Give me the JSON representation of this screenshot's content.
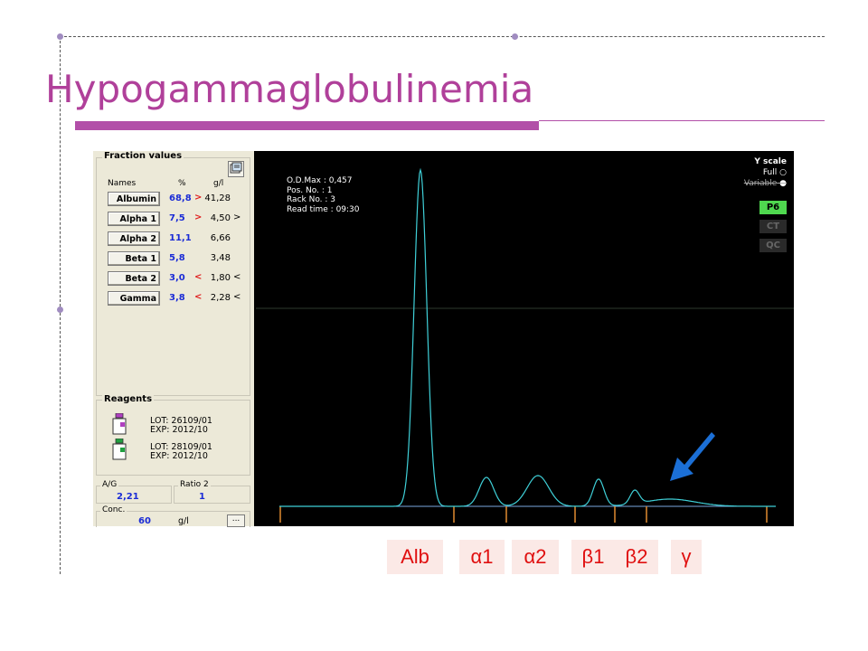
{
  "slide": {
    "title": "Hypogammaglobulinemia",
    "accent_color": "#b24fa8"
  },
  "fraction_panel": {
    "group_title": "Fraction values",
    "col_names": "Names",
    "col_pct": "%",
    "col_gl": "g/l",
    "rows": [
      {
        "name": "Albumin",
        "pct": "68,8",
        "pct_flag": ">",
        "gl": "41,28",
        "gl_flag": ""
      },
      {
        "name": "Alpha 1",
        "pct": "7,5",
        "pct_flag": ">",
        "gl": "4,50",
        "gl_flag": ">"
      },
      {
        "name": "Alpha 2",
        "pct": "11,1",
        "pct_flag": "",
        "gl": "6,66",
        "gl_flag": ""
      },
      {
        "name": "Beta 1",
        "pct": "5,8",
        "pct_flag": "",
        "gl": "3,48",
        "gl_flag": ""
      },
      {
        "name": "Beta 2",
        "pct": "3,0",
        "pct_flag": "<",
        "gl": "1,80",
        "gl_flag": "<"
      },
      {
        "name": "Gamma",
        "pct": "3,8",
        "pct_flag": "<",
        "gl": "2,28",
        "gl_flag": "<"
      }
    ]
  },
  "reagents": {
    "group_title": "Reagents",
    "items": [
      {
        "lot": "LOT:  26109/01",
        "exp": "EXP:  2012/10"
      },
      {
        "lot": "LOT:  28109/01",
        "exp": "EXP:  2012/10"
      }
    ]
  },
  "ratios": {
    "ag_label": "A/G",
    "ag_value": "2,21",
    "ratio2_label": "Ratio 2",
    "ratio2_value": "1"
  },
  "conc": {
    "label": "Conc.",
    "value": "60",
    "unit": "g/l",
    "more_button": "..."
  },
  "plot": {
    "info_lines": [
      "O.D.Max : 0,457",
      "Pos. No.  : 1",
      "Rack No.  : 3",
      "Read time : 09:30"
    ],
    "yscale_label": "Y scale",
    "yscale_full": "Full",
    "yscale_variable": "Variable",
    "buttons": [
      "P6",
      "CT",
      "QC"
    ],
    "trace_color": "#3fd0d8",
    "divider_color": "#e08a30"
  },
  "fraction_labels": [
    "Alb",
    "α1",
    "α2",
    "β1",
    "β2",
    "γ"
  ],
  "arrow_color": "#1b6fd6"
}
